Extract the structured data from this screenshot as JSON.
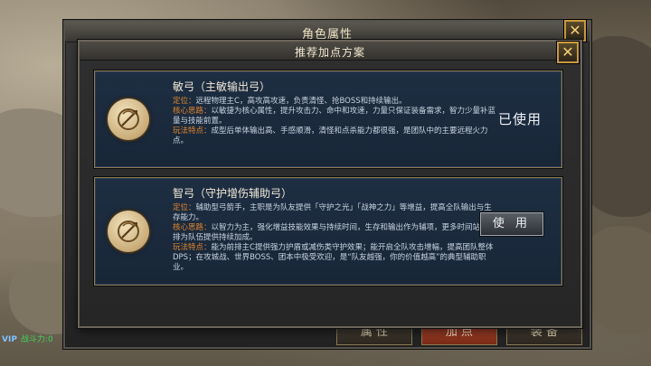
{
  "window": {
    "title": "角色属性",
    "close_symbol": "✕",
    "tabs": [
      {
        "label": "属 性"
      },
      {
        "label": "加 点"
      },
      {
        "label": "装 备"
      }
    ]
  },
  "hud": {
    "left_text": "VIP",
    "left_value": "战斗力:0"
  },
  "dialog": {
    "title": "推荐加点方案",
    "close_symbol": "✕",
    "plans": [
      {
        "name": "敏弓（主敏输出弓）",
        "lines": [
          {
            "label": "定位：",
            "text": "远程物理主C，高攻高攻速，负责清怪、抢BOSS和持续输出。"
          },
          {
            "label": "核心思路：",
            "text": "以敏捷为核心属性，提升攻击力、命中和攻速，力量只保证装备需求，智力少量补蓝量与技能前置。"
          },
          {
            "label": "玩法特点：",
            "text": "成型后单体输出高、手感顺滑，清怪和点杀能力都很强，是团队中的主要远程火力点。"
          }
        ],
        "status": "已使用"
      },
      {
        "name": "智弓（守护增伤辅助弓）",
        "lines": [
          {
            "label": "定位：",
            "text": "辅助型弓箭手，主职是为队友提供「守护之光」「战神之力」等增益，提高全队输出与生存能力。"
          },
          {
            "label": "核心思路：",
            "text": "以智力为主，强化增益技能效果与持续时间，生存和输出作为辅项，更多时间站在后排为队伍提供持续加成。"
          },
          {
            "label": "玩法特点：",
            "text": "能为前排主C提供强力护盾或减伤类守护效果；能开启全队攻击增幅，提高团队整体DPS；在攻城战、世界BOSS、团本中极受欢迎，是“队友越强，你的价值越高”的典型辅助职业。"
          }
        ],
        "action": "使 用"
      }
    ]
  },
  "icons": {
    "emblem": "bow-emblem-icon",
    "close": "close-icon"
  },
  "colors": {
    "accent": "#e0852e",
    "gold_border": "#c89a3e",
    "card_bg": "#1e2e42"
  }
}
